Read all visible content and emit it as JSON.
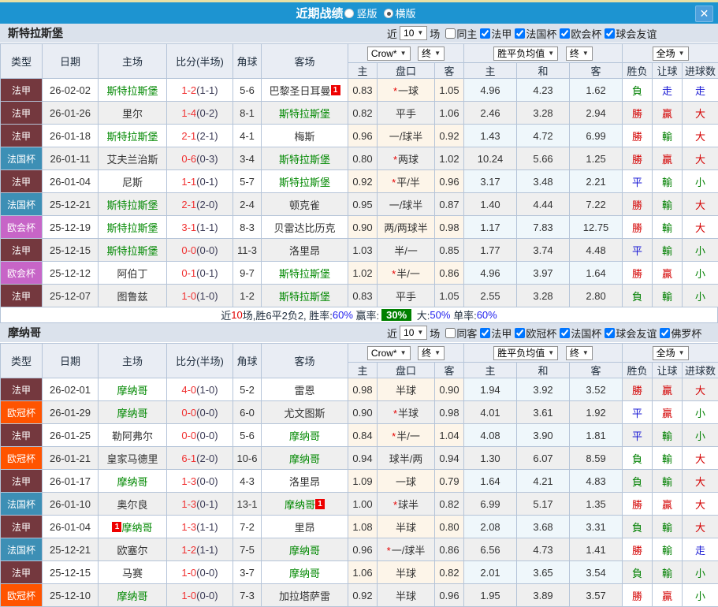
{
  "titlebar": {
    "title": "近期战绩",
    "radio_options": [
      {
        "label": "竖版",
        "selected": false
      },
      {
        "label": "横版",
        "selected": true
      }
    ],
    "close_icon": "✕"
  },
  "icons": {
    "caret": "▼"
  },
  "filters_common": {
    "recent_label": "近",
    "count": "10",
    "games_label": "场"
  },
  "table": {
    "main_columns": [
      "类型",
      "日期",
      "主场",
      "比分(半场)",
      "角球",
      "客场"
    ],
    "sub_columns": [
      "主",
      "盘口",
      "客",
      "主",
      "和",
      "客",
      "胜负",
      "让球",
      "进球数"
    ],
    "bookmaker": "Crow*",
    "odds_time": "终",
    "mean_type": "胜平负均值",
    "mean_time": "终",
    "scope": "全场"
  },
  "league_colors": {
    "法甲": "#74383E",
    "法国杯": "#3D8FB5",
    "欧会杯": "#C765C7",
    "欧冠杯": "#FF5400"
  },
  "result_colors": {
    "red": "#D40000",
    "blue": "#1A1AD4",
    "green": "#008000"
  },
  "sections": [
    {
      "team": "斯特拉斯堡",
      "same_label": "同主",
      "same_checked": false,
      "leagues": [
        "法甲",
        "法国杯",
        "欧会杯",
        "球会友谊"
      ],
      "rows": [
        {
          "league": "法甲",
          "date": "26-02-02",
          "home": "斯特拉斯堡",
          "home_hl": true,
          "score": "1-2",
          "half": "(1-1)",
          "corner": "5-6",
          "away": "巴黎圣日耳曼",
          "away_hl": false,
          "away_badge": "1",
          "odds_home": "0.83",
          "handicap": "一球",
          "handicap_star": true,
          "odds_away": "1.05",
          "mean_home": "4.96",
          "mean_draw": "4.23",
          "mean_away": "1.62",
          "res": [
            [
              "負",
              "green"
            ],
            [
              "走",
              "blue"
            ],
            [
              "走",
              "blue"
            ]
          ]
        },
        {
          "league": "法甲",
          "date": "26-01-26",
          "home": "里尔",
          "home_hl": false,
          "score": "1-4",
          "half": "(0-2)",
          "corner": "8-1",
          "away": "斯特拉斯堡",
          "away_hl": true,
          "odds_home": "0.82",
          "handicap": "平手",
          "handicap_star": false,
          "odds_away": "1.06",
          "mean_home": "2.46",
          "mean_draw": "3.28",
          "mean_away": "2.94",
          "res": [
            [
              "勝",
              "red"
            ],
            [
              "贏",
              "red"
            ],
            [
              "大",
              "red"
            ]
          ]
        },
        {
          "league": "法甲",
          "date": "26-01-18",
          "home": "斯特拉斯堡",
          "home_hl": true,
          "score": "2-1",
          "half": "(2-1)",
          "corner": "4-1",
          "away": "梅斯",
          "away_hl": false,
          "odds_home": "0.96",
          "handicap": "一/球半",
          "handicap_star": false,
          "odds_away": "0.92",
          "mean_home": "1.43",
          "mean_draw": "4.72",
          "mean_away": "6.99",
          "res": [
            [
              "勝",
              "red"
            ],
            [
              "輸",
              "green"
            ],
            [
              "大",
              "red"
            ]
          ]
        },
        {
          "league": "法国杯",
          "date": "26-01-11",
          "home": "艾夫兰治斯",
          "home_hl": false,
          "score": "0-6",
          "half": "(0-3)",
          "corner": "3-4",
          "away": "斯特拉斯堡",
          "away_hl": true,
          "odds_home": "0.80",
          "handicap": "两球",
          "handicap_star": true,
          "odds_away": "1.02",
          "mean_home": "10.24",
          "mean_draw": "5.66",
          "mean_away": "1.25",
          "res": [
            [
              "勝",
              "red"
            ],
            [
              "贏",
              "red"
            ],
            [
              "大",
              "red"
            ]
          ]
        },
        {
          "league": "法甲",
          "date": "26-01-04",
          "home": "尼斯",
          "home_hl": false,
          "score": "1-1",
          "half": "(0-1)",
          "corner": "5-7",
          "away": "斯特拉斯堡",
          "away_hl": true,
          "odds_home": "0.92",
          "handicap": "平/半",
          "handicap_star": true,
          "odds_away": "0.96",
          "mean_home": "3.17",
          "mean_draw": "3.48",
          "mean_away": "2.21",
          "res": [
            [
              "平",
              "blue"
            ],
            [
              "輸",
              "green"
            ],
            [
              "小",
              "green"
            ]
          ]
        },
        {
          "league": "法国杯",
          "date": "25-12-21",
          "home": "斯特拉斯堡",
          "home_hl": true,
          "score": "2-1",
          "half": "(2-0)",
          "corner": "2-4",
          "away": "顿克雀",
          "away_hl": false,
          "odds_home": "0.95",
          "handicap": "一/球半",
          "handicap_star": false,
          "odds_away": "0.87",
          "mean_home": "1.40",
          "mean_draw": "4.44",
          "mean_away": "7.22",
          "res": [
            [
              "勝",
              "red"
            ],
            [
              "輸",
              "green"
            ],
            [
              "大",
              "red"
            ]
          ]
        },
        {
          "league": "欧会杯",
          "date": "25-12-19",
          "home": "斯特拉斯堡",
          "home_hl": true,
          "score": "3-1",
          "half": "(1-1)",
          "corner": "8-3",
          "away": "贝雷达比历克",
          "away_hl": false,
          "odds_home": "0.90",
          "handicap": "两/两球半",
          "handicap_star": false,
          "odds_away": "0.98",
          "mean_home": "1.17",
          "mean_draw": "7.83",
          "mean_away": "12.75",
          "res": [
            [
              "勝",
              "red"
            ],
            [
              "輸",
              "green"
            ],
            [
              "大",
              "red"
            ]
          ]
        },
        {
          "league": "法甲",
          "date": "25-12-15",
          "home": "斯特拉斯堡",
          "home_hl": true,
          "score": "0-0",
          "half": "(0-0)",
          "corner": "11-3",
          "away": "洛里昂",
          "away_hl": false,
          "odds_home": "1.03",
          "handicap": "半/一",
          "handicap_star": false,
          "odds_away": "0.85",
          "mean_home": "1.77",
          "mean_draw": "3.74",
          "mean_away": "4.48",
          "res": [
            [
              "平",
              "blue"
            ],
            [
              "輸",
              "green"
            ],
            [
              "小",
              "green"
            ]
          ]
        },
        {
          "league": "欧会杯",
          "date": "25-12-12",
          "home": "阿伯丁",
          "home_hl": false,
          "score": "0-1",
          "half": "(0-1)",
          "corner": "9-7",
          "away": "斯特拉斯堡",
          "away_hl": true,
          "odds_home": "1.02",
          "handicap": "半/一",
          "handicap_star": true,
          "odds_away": "0.86",
          "mean_home": "4.96",
          "mean_draw": "3.97",
          "mean_away": "1.64",
          "res": [
            [
              "勝",
              "red"
            ],
            [
              "贏",
              "red"
            ],
            [
              "小",
              "green"
            ]
          ]
        },
        {
          "league": "法甲",
          "date": "25-12-07",
          "home": "图鲁兹",
          "home_hl": false,
          "score": "1-0",
          "half": "(1-0)",
          "corner": "1-2",
          "away": "斯特拉斯堡",
          "away_hl": true,
          "odds_home": "0.83",
          "handicap": "平手",
          "handicap_star": false,
          "odds_away": "1.05",
          "mean_home": "2.55",
          "mean_draw": "3.28",
          "mean_away": "2.80",
          "res": [
            [
              "負",
              "green"
            ],
            [
              "輸",
              "green"
            ],
            [
              "小",
              "green"
            ]
          ]
        }
      ],
      "summary_segments": [
        {
          "text": "近",
          "style": "plain"
        },
        {
          "text": "10",
          "style": "red"
        },
        {
          "text": "场,胜6平2负2, 胜率:",
          "style": "plain"
        },
        {
          "text": "60%",
          "style": "blue"
        },
        {
          "text": " 赢率:",
          "style": "plain"
        },
        {
          "text": "30%",
          "style": "chip"
        },
        {
          "text": " 大:",
          "style": "plain"
        },
        {
          "text": "50%",
          "style": "blue"
        },
        {
          "text": " 单率:",
          "style": "plain"
        },
        {
          "text": "60%",
          "style": "blue"
        }
      ]
    },
    {
      "team": "摩纳哥",
      "same_label": "同客",
      "same_checked": false,
      "leagues": [
        "法甲",
        "欧冠杯",
        "法国杯",
        "球会友谊",
        "佛罗杯"
      ],
      "rows": [
        {
          "league": "法甲",
          "date": "26-02-01",
          "home": "摩纳哥",
          "home_hl": true,
          "score": "4-0",
          "half": "(1-0)",
          "corner": "5-2",
          "away": "雷恩",
          "away_hl": false,
          "odds_home": "0.98",
          "handicap": "半球",
          "handicap_star": false,
          "odds_away": "0.90",
          "mean_home": "1.94",
          "mean_draw": "3.92",
          "mean_away": "3.52",
          "res": [
            [
              "勝",
              "red"
            ],
            [
              "贏",
              "red"
            ],
            [
              "大",
              "red"
            ]
          ]
        },
        {
          "league": "欧冠杯",
          "date": "26-01-29",
          "home": "摩纳哥",
          "home_hl": true,
          "score": "0-0",
          "half": "(0-0)",
          "corner": "6-0",
          "away": "尤文图斯",
          "away_hl": false,
          "odds_home": "0.90",
          "handicap": "半球",
          "handicap_star": true,
          "odds_away": "0.98",
          "mean_home": "4.01",
          "mean_draw": "3.61",
          "mean_away": "1.92",
          "res": [
            [
              "平",
              "blue"
            ],
            [
              "贏",
              "red"
            ],
            [
              "小",
              "green"
            ]
          ]
        },
        {
          "league": "法甲",
          "date": "26-01-25",
          "home": "勒阿弗尔",
          "home_hl": false,
          "score": "0-0",
          "half": "(0-0)",
          "corner": "5-6",
          "away": "摩纳哥",
          "away_hl": true,
          "odds_home": "0.84",
          "handicap": "半/一",
          "handicap_star": true,
          "odds_away": "1.04",
          "mean_home": "4.08",
          "mean_draw": "3.90",
          "mean_away": "1.81",
          "res": [
            [
              "平",
              "blue"
            ],
            [
              "輸",
              "green"
            ],
            [
              "小",
              "green"
            ]
          ]
        },
        {
          "league": "欧冠杯",
          "date": "26-01-21",
          "home": "皇家马德里",
          "home_hl": false,
          "score": "6-1",
          "half": "(2-0)",
          "corner": "10-6",
          "away": "摩纳哥",
          "away_hl": true,
          "odds_home": "0.94",
          "handicap": "球半/两",
          "handicap_star": false,
          "odds_away": "0.94",
          "mean_home": "1.30",
          "mean_draw": "6.07",
          "mean_away": "8.59",
          "res": [
            [
              "負",
              "green"
            ],
            [
              "輸",
              "green"
            ],
            [
              "大",
              "red"
            ]
          ]
        },
        {
          "league": "法甲",
          "date": "26-01-17",
          "home": "摩纳哥",
          "home_hl": true,
          "score": "1-3",
          "half": "(0-0)",
          "corner": "4-3",
          "away": "洛里昂",
          "away_hl": false,
          "odds_home": "1.09",
          "handicap": "一球",
          "handicap_star": false,
          "odds_away": "0.79",
          "mean_home": "1.64",
          "mean_draw": "4.21",
          "mean_away": "4.83",
          "res": [
            [
              "負",
              "green"
            ],
            [
              "輸",
              "green"
            ],
            [
              "大",
              "red"
            ]
          ]
        },
        {
          "league": "法国杯",
          "date": "26-01-10",
          "home": "奥尔良",
          "home_hl": false,
          "score": "1-3",
          "half": "(0-1)",
          "corner": "13-1",
          "away": "摩纳哥",
          "away_hl": true,
          "away_badge": "1",
          "odds_home": "1.00",
          "handicap": "球半",
          "handicap_star": true,
          "odds_away": "0.82",
          "mean_home": "6.99",
          "mean_draw": "5.17",
          "mean_away": "1.35",
          "res": [
            [
              "勝",
              "red"
            ],
            [
              "贏",
              "red"
            ],
            [
              "大",
              "red"
            ]
          ]
        },
        {
          "league": "法甲",
          "date": "26-01-04",
          "home": "摩纳哥",
          "home_hl": true,
          "home_badge": "1",
          "home_badge_pos": "before",
          "score": "1-3",
          "half": "(1-1)",
          "corner": "7-2",
          "away": "里昂",
          "away_hl": false,
          "odds_home": "1.08",
          "handicap": "半球",
          "handicap_star": false,
          "odds_away": "0.80",
          "mean_home": "2.08",
          "mean_draw": "3.68",
          "mean_away": "3.31",
          "res": [
            [
              "負",
              "green"
            ],
            [
              "輸",
              "green"
            ],
            [
              "大",
              "red"
            ]
          ]
        },
        {
          "league": "法国杯",
          "date": "25-12-21",
          "home": "欧塞尔",
          "home_hl": false,
          "score": "1-2",
          "half": "(1-1)",
          "corner": "7-5",
          "away": "摩纳哥",
          "away_hl": true,
          "odds_home": "0.96",
          "handicap": "一/球半",
          "handicap_star": true,
          "odds_away": "0.86",
          "mean_home": "6.56",
          "mean_draw": "4.73",
          "mean_away": "1.41",
          "res": [
            [
              "勝",
              "red"
            ],
            [
              "輸",
              "green"
            ],
            [
              "走",
              "blue"
            ]
          ]
        },
        {
          "league": "法甲",
          "date": "25-12-15",
          "home": "马赛",
          "home_hl": false,
          "score": "1-0",
          "half": "(0-0)",
          "corner": "3-7",
          "away": "摩纳哥",
          "away_hl": true,
          "odds_home": "1.06",
          "handicap": "半球",
          "handicap_star": false,
          "odds_away": "0.82",
          "mean_home": "2.01",
          "mean_draw": "3.65",
          "mean_away": "3.54",
          "res": [
            [
              "負",
              "green"
            ],
            [
              "輸",
              "green"
            ],
            [
              "小",
              "green"
            ]
          ]
        },
        {
          "league": "欧冠杯",
          "date": "25-12-10",
          "home": "摩纳哥",
          "home_hl": true,
          "score": "1-0",
          "half": "(0-0)",
          "corner": "7-3",
          "away": "加拉塔萨雷",
          "away_hl": false,
          "odds_home": "0.92",
          "handicap": "半球",
          "handicap_star": false,
          "odds_away": "0.96",
          "mean_home": "1.95",
          "mean_draw": "3.89",
          "mean_away": "3.57",
          "res": [
            [
              "勝",
              "red"
            ],
            [
              "贏",
              "red"
            ],
            [
              "小",
              "green"
            ]
          ]
        }
      ],
      "summary_segments": null
    }
  ]
}
